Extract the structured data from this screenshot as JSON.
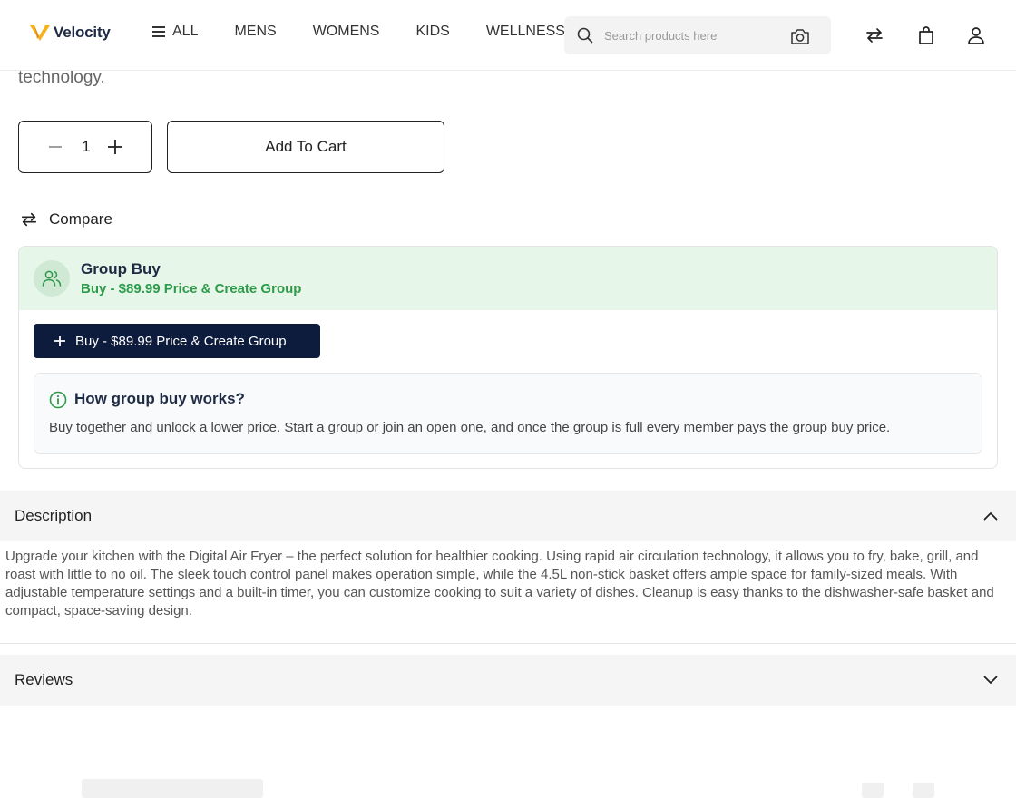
{
  "header": {
    "logo_text": "Velocity",
    "nav": [
      "ALL",
      "MENS",
      "WOMENS",
      "KIDS",
      "WELLNESS"
    ],
    "search_placeholder": "Search products here"
  },
  "product": {
    "description_tail": "technology.",
    "quantity": "1",
    "add_to_cart_label": "Add To Cart",
    "compare_label": "Compare"
  },
  "group_buy": {
    "title": "Group Buy",
    "subtitle": "Buy - $89.99 Price & Create Group",
    "button_label": "Buy - $89.99 Price & Create Group",
    "how_title": "How group buy works?",
    "how_text": "Buy together and unlock a lower price. Start a group or join an open one, and once the group is full every member pays the group buy price."
  },
  "accordion": {
    "description_title": "Description",
    "description_body": " Upgrade your kitchen with the Digital Air Fryer – the perfect solution for healthier cooking. Using rapid air circulation technology, it allows you to fry, bake, grill, and roast with little to no oil. The sleek touch control panel makes operation simple, while the 4.5L non-stick basket offers ample space for family-sized meals. With adjustable temperature settings and a built-in timer, you can customize cooking to suit a variety of dishes. Cleanup is easy thanks to the dishwasher-safe basket and compact, space-saving design.",
    "reviews_title": "Reviews"
  },
  "colors": {
    "brand_navy": "#0d1b3d",
    "group_green": "#2e9a4a",
    "group_bg": "#e6f7e9",
    "logo_gold": "#f5b21b"
  }
}
